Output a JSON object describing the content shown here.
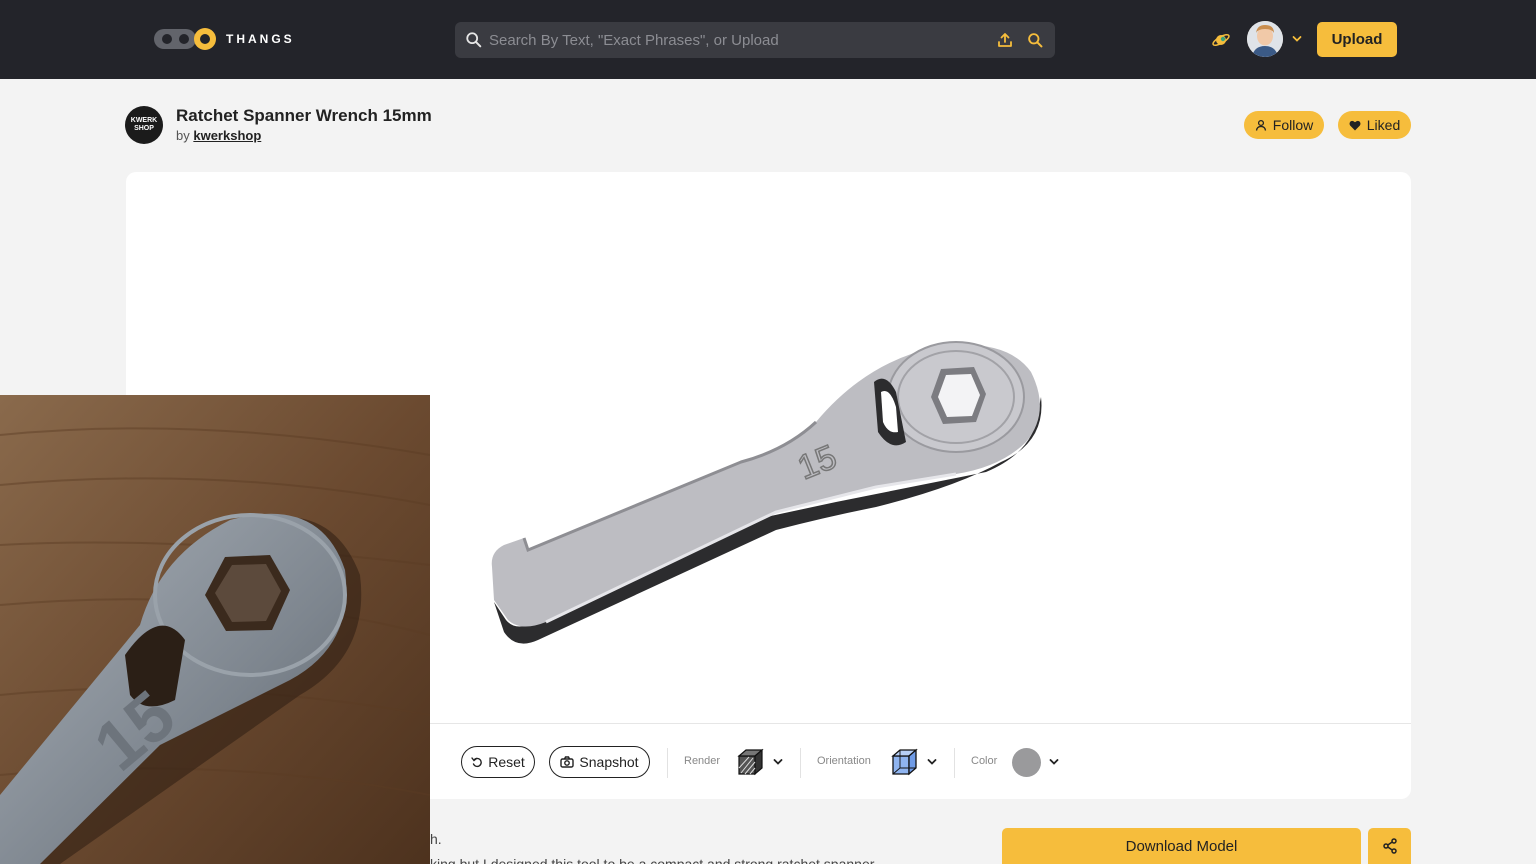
{
  "header": {
    "logo_text": "THANGS",
    "search_placeholder": "Search By Text, \"Exact Phrases\", or Upload",
    "upload_label": "Upload"
  },
  "model": {
    "shop_logo_line1": "KWERK",
    "shop_logo_line2": "SHOP",
    "title": "Ratchet Spanner Wrench 15mm",
    "by_prefix": "by",
    "author": "kwerkshop",
    "follow_label": "Follow",
    "liked_label": "Liked"
  },
  "viewer": {
    "reset_label": "Reset",
    "snapshot_label": "Snapshot",
    "render_label": "Render",
    "orientation_label": "Orientation",
    "color_label": "Color"
  },
  "description": {
    "fragment1": "h.",
    "fragment2": "king but I designed this tool to be a compact and strong ratchet spanner"
  },
  "actions": {
    "download_label": "Download Model"
  },
  "colors": {
    "accent": "#f6bd3c",
    "header_bg": "#23242a",
    "page_bg": "#f3f3f3"
  }
}
